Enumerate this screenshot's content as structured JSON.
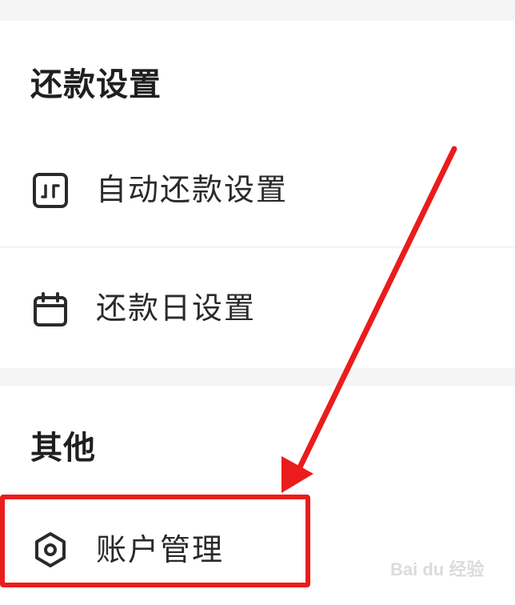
{
  "sections": [
    {
      "title": "还款设置",
      "items": [
        {
          "label": "自动还款设置",
          "icon": "auto-repay-icon"
        },
        {
          "label": "还款日设置",
          "icon": "calendar-icon"
        }
      ]
    },
    {
      "title": "其他",
      "items": [
        {
          "label": "账户管理",
          "icon": "hexagon-settings-icon"
        }
      ]
    }
  ],
  "annotation": {
    "highlight_color": "#ea1c1c",
    "highlighted_item": "账户管理"
  },
  "watermark": {
    "text": "Bai du 经验"
  },
  "colors": {
    "text": "#222222",
    "section_gap": "#f5f5f5",
    "accent_red": "#ea1c1c"
  }
}
